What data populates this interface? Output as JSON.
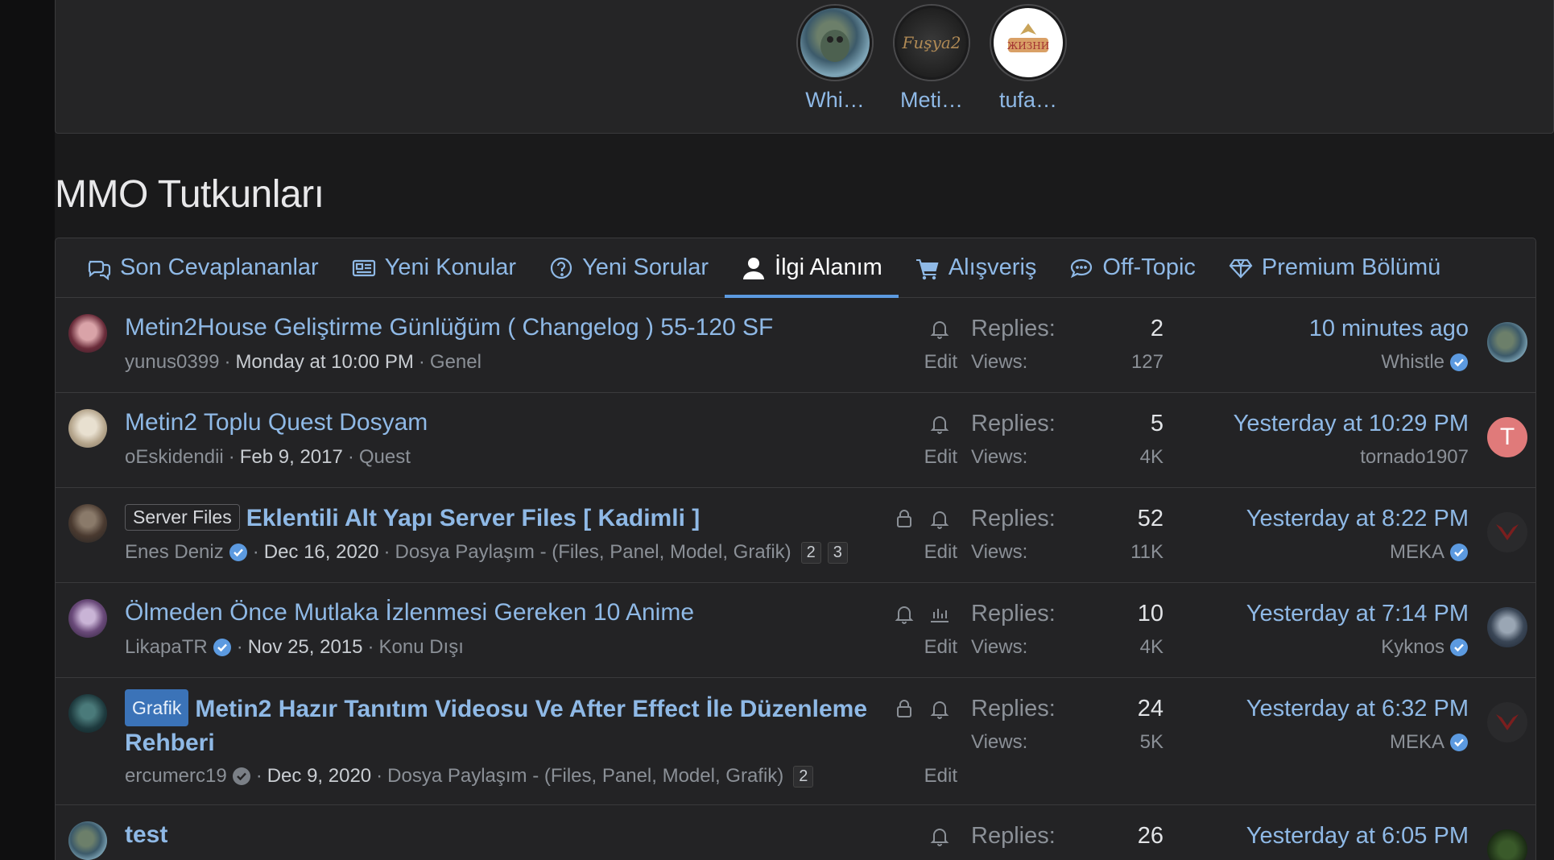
{
  "favorites": [
    {
      "name": "Whi…",
      "avatar": "whistle-avatar"
    },
    {
      "name": "Meti…",
      "avatar": "fusya2-avatar"
    },
    {
      "name": "tufa…",
      "avatar": "tufan-avatar"
    }
  ],
  "section_title": "MMO Tutkunları",
  "tabs": [
    {
      "label": "Son Cevaplananlar",
      "icon": "comments-icon"
    },
    {
      "label": "Yeni Konular",
      "icon": "newspaper-icon"
    },
    {
      "label": "Yeni Sorular",
      "icon": "question-circle-icon"
    },
    {
      "label": "İlgi Alanım",
      "icon": "user-icon",
      "active": true
    },
    {
      "label": "Alışveriş",
      "icon": "cart-icon"
    },
    {
      "label": "Off-Topic",
      "icon": "chat-icon"
    },
    {
      "label": "Premium Bölümü",
      "icon": "diamond-icon"
    }
  ],
  "labels": {
    "replies": "Replies:",
    "views": "Views:",
    "edit": "Edit"
  },
  "threads": [
    {
      "title": "Metin2House Geliştirme Günlüğüm ( Changelog ) 55-120 SF",
      "author": "yunus0399",
      "date": "Monday at 10:00 PM",
      "forum": "Genel",
      "replies": "2",
      "views": "127",
      "last_date": "10 minutes ago",
      "last_user": "Whistle"
    },
    {
      "title": "Metin2 Toplu Quest Dosyam",
      "author": "oEskidendii",
      "date": "Feb 9, 2017",
      "forum": "Quest",
      "replies": "5",
      "views": "4K",
      "last_date": "Yesterday at 10:29 PM",
      "last_user": "tornado1907",
      "last_avatar_letter": "T"
    },
    {
      "prefix": "Server Files",
      "title": "Eklentili Alt Yapı Server Files [ Kadimli ]",
      "author": "Enes Deniz",
      "date": "Dec 16, 2020",
      "forum": "Dosya Paylaşım - (Files, Panel, Model, Grafik)",
      "pages": [
        "2",
        "3"
      ],
      "replies": "52",
      "views": "11K",
      "last_date": "Yesterday at 8:22 PM",
      "last_user": "MEKA"
    },
    {
      "title": "Ölmeden Önce Mutlaka İzlenmesi Gereken 10 Anime",
      "author": "LikapaTR",
      "date": "Nov 25, 2015",
      "forum": "Konu Dışı",
      "replies": "10",
      "views": "4K",
      "last_date": "Yesterday at 7:14 PM",
      "last_user": "Kyknos"
    },
    {
      "prefix": "Grafik",
      "title": "Metin2 Hazır Tanıtım Videosu Ve After Effect İle Düzenleme Rehberi",
      "author": "ercumerc19",
      "date": "Dec 9, 2020",
      "forum": "Dosya Paylaşım - (Files, Panel, Model, Grafik)",
      "pages": [
        "2"
      ],
      "replies": "24",
      "views": "5K",
      "last_date": "Yesterday at 6:32 PM",
      "last_user": "MEKA"
    },
    {
      "title": "test",
      "replies": "26",
      "last_date": "Yesterday at 6:05 PM"
    }
  ]
}
